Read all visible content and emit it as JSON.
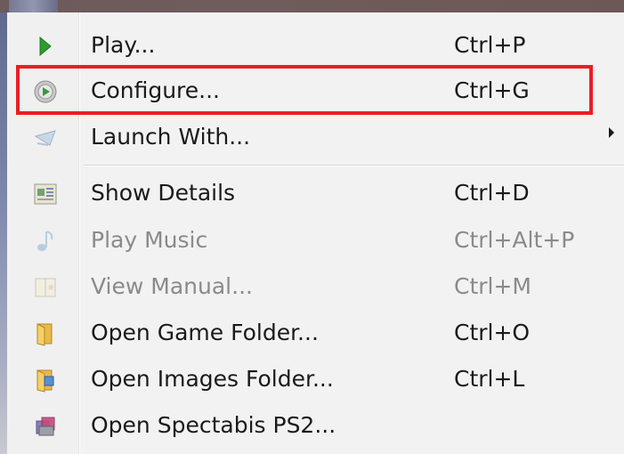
{
  "menu": {
    "items": [
      {
        "label": "Play...",
        "shortcut": "Ctrl+P",
        "icon": "play-icon",
        "enabled": true
      },
      {
        "label": "Configure...",
        "shortcut": "Ctrl+G",
        "icon": "configure-icon",
        "enabled": true,
        "highlighted": true
      },
      {
        "label": "Launch With...",
        "shortcut": "",
        "icon": "launch-icon",
        "enabled": true,
        "has_submenu": true
      },
      {
        "label": "Show Details",
        "shortcut": "Ctrl+D",
        "icon": "details-icon",
        "enabled": true
      },
      {
        "label": "Play Music",
        "shortcut": "Ctrl+Alt+P",
        "icon": "music-note-icon",
        "enabled": false
      },
      {
        "label": "View Manual...",
        "shortcut": "Ctrl+M",
        "icon": "manual-icon",
        "enabled": false
      },
      {
        "label": "Open Game Folder...",
        "shortcut": "Ctrl+O",
        "icon": "folder-icon",
        "enabled": true
      },
      {
        "label": "Open Images Folder...",
        "shortcut": "Ctrl+L",
        "icon": "images-folder-icon",
        "enabled": true
      },
      {
        "label": "Open Spectabis PS2...",
        "shortcut": "",
        "icon": "spectabis-icon",
        "enabled": true
      }
    ]
  },
  "colors": {
    "highlight_border": "#ec1c24",
    "menu_background": "#f2f2f2",
    "disabled_text": "#8a8a8a",
    "play_green": "#2e9c2e"
  }
}
